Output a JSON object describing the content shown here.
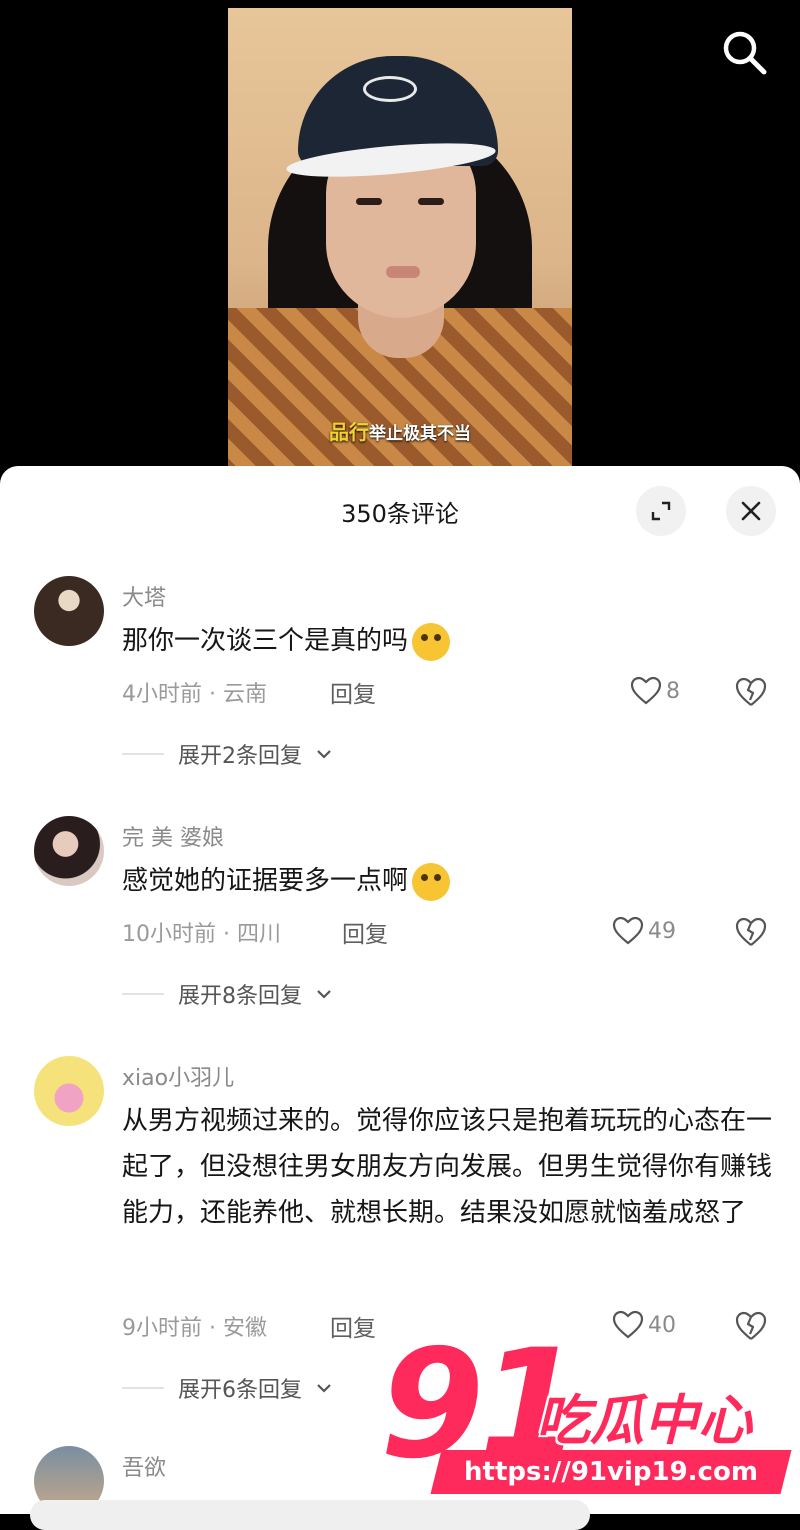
{
  "video": {
    "subtitle_highlight": "品行",
    "subtitle_rest": "举止极其不当"
  },
  "comments_panel": {
    "title": "350条评论"
  },
  "comments": [
    {
      "username": "大塔",
      "text": "那你一次谈三个是真的吗",
      "emoji": "laughing-crying-emoji",
      "time": "4小时前 · 云南",
      "reply_label": "回复",
      "likes": "8",
      "expand_label": "展开2条回复"
    },
    {
      "username": "完 美 婆娘",
      "text": "感觉她的证据要多一点啊",
      "emoji": "dizzy-face-emoji",
      "time": "10小时前 · 四川",
      "reply_label": "回复",
      "likes": "49",
      "expand_label": "展开8条回复"
    },
    {
      "username": "xiao小羽儿",
      "text": "从男方视频过来的。觉得你应该只是抱着玩玩的心态在一起了，但没想往男女朋友方向发展。但男生觉得你有赚钱能力，还能养他、就想长期。结果没如愿就恼羞成怒了",
      "time": "9小时前 · 安徽",
      "reply_label": "回复",
      "likes": "40",
      "expand_label": "展开6条回复"
    },
    {
      "username": "吾欲"
    }
  ],
  "watermark": {
    "number": "91",
    "brand": "吃瓜中心",
    "url": "https://91vip19.com"
  },
  "colors": {
    "watermark_pink": "#ff2a5c",
    "subtitle_yellow": "#f2d230"
  }
}
